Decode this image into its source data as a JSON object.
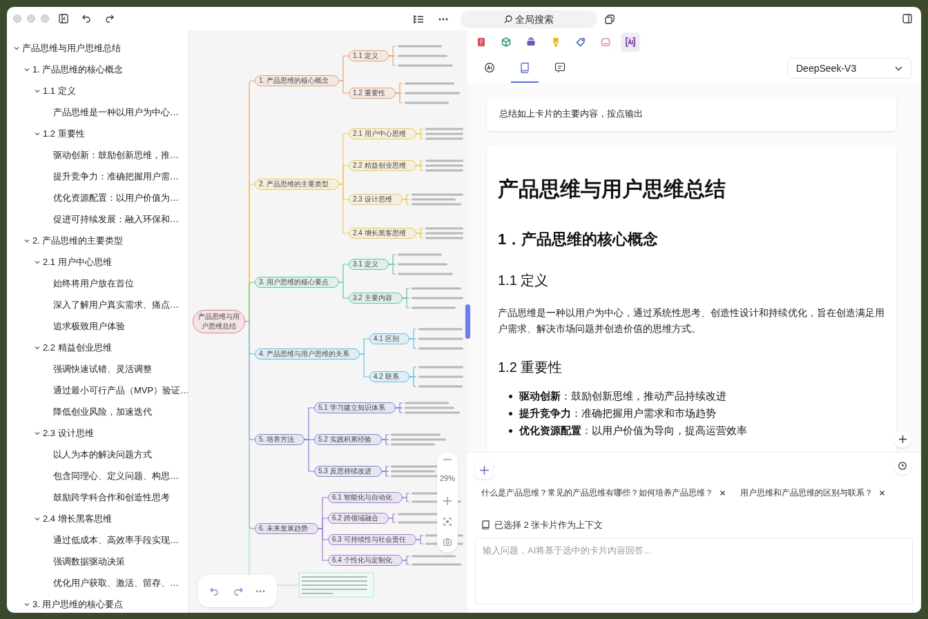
{
  "window": {
    "search_label": "全局搜索"
  },
  "outline": [
    {
      "text": "产品思维与用户思维总结",
      "expanded": true,
      "children": [
        {
          "text": "1. 产品思维的核心概念",
          "expanded": true,
          "children": [
            {
              "text": "1.1 定义",
              "expanded": true,
              "children": [
                {
                  "text": "产品思维是一种以用户为中心…"
                }
              ]
            },
            {
              "text": "1.2 重要性",
              "expanded": true,
              "children": [
                {
                  "text": "驱动创新：鼓励创新思维，推…"
                },
                {
                  "text": "提升竞争力：准确把握用户需…"
                },
                {
                  "text": "优化资源配置：以用户价值为…"
                },
                {
                  "text": "促进可持续发展：融入环保和…"
                }
              ]
            }
          ]
        },
        {
          "text": "2. 产品思维的主要类型",
          "expanded": true,
          "children": [
            {
              "text": "2.1 用户中心思维",
              "expanded": true,
              "children": [
                {
                  "text": "始终将用户放在首位"
                },
                {
                  "text": "深入了解用户真实需求、痛点…"
                },
                {
                  "text": "追求极致用户体验"
                }
              ]
            },
            {
              "text": "2.2 精益创业思维",
              "expanded": true,
              "children": [
                {
                  "text": "强调快速试错、灵活调整"
                },
                {
                  "text": "通过最小可行产品（MVP）验证…"
                },
                {
                  "text": "降低创业风险，加速迭代"
                }
              ]
            },
            {
              "text": "2.3 设计思维",
              "expanded": true,
              "children": [
                {
                  "text": "以人为本的解决问题方式"
                },
                {
                  "text": "包含同理心、定义问题、构思…"
                },
                {
                  "text": "鼓励跨学科合作和创造性思考"
                }
              ]
            },
            {
              "text": "2.4 增长黑客思维",
              "expanded": true,
              "children": [
                {
                  "text": "通过低成本、高效率手段实现…"
                },
                {
                  "text": "强调数据驱动决策"
                },
                {
                  "text": "优化用户获取、激活、留存、…"
                }
              ]
            }
          ]
        },
        {
          "text": "3. 用户思维的核心要点",
          "expanded": true
        }
      ]
    }
  ],
  "mindmap": {
    "root": "产品思维与用户思维总结",
    "branches": [
      {
        "label": "1. 产品思维的核心概念",
        "color": "#f0a06a",
        "children": [
          "1.1 定义",
          "1.2 重要性"
        ]
      },
      {
        "label": "2. 产品思维的主要类型",
        "color": "#f2c94c",
        "children": [
          "2.1 用户中心思维",
          "2.2 精益创业思维",
          "2.3 设计思维",
          "2.4 增长黑客思维"
        ]
      },
      {
        "label": "3. 用户思维的核心要点",
        "color": "#5cc9a0",
        "children": [
          "3.1 定义",
          "3.2 主要内容"
        ]
      },
      {
        "label": "4. 产品思维与用户思维的关系",
        "color": "#5bc0eb",
        "children": [
          "4.1 区别",
          "4.2 联系"
        ]
      },
      {
        "label": "5. 培养方法",
        "color": "#7b86d9",
        "children": [
          "5.1 学习建立知识体系",
          "5.2 实践积累经验",
          "5.3 反思持续改进"
        ]
      },
      {
        "label": "6. 未来发展趋势",
        "color": "#a27be0",
        "children": [
          "6.1 智能化与自动化",
          "6.2 跨领域融合",
          "6.3 可持续性与社会责任",
          "6.4 个性化与定制化"
        ]
      }
    ]
  },
  "canvas": {
    "zoom": "29%"
  },
  "tools": [
    {
      "kind": "note",
      "color": "#e5484d",
      "selected": false
    },
    {
      "kind": "cube",
      "color": "#30a46c",
      "selected": false
    },
    {
      "kind": "stack",
      "color": "#6e56cf",
      "selected": false
    },
    {
      "kind": "marker",
      "color": "#f5b400",
      "selected": false
    },
    {
      "kind": "tag",
      "color": "#3e63dd",
      "selected": false
    },
    {
      "kind": "frame",
      "color": "#f38bb5",
      "selected": false
    },
    {
      "kind": "ai",
      "color": "#8e4ec6",
      "selected": true
    }
  ],
  "tabs": [
    {
      "kind": "ai",
      "selected": false
    },
    {
      "kind": "book",
      "selected": true
    },
    {
      "kind": "chat",
      "selected": false
    }
  ],
  "model": "DeepSeek-V3",
  "prompt": "总结如上卡片的主要内容，按点输出",
  "answer": {
    "title": "产品思维与用户思维总结",
    "blocks": [
      {
        "kind": "h2",
        "text": "1．产品思维的核心概念"
      },
      {
        "kind": "h3",
        "text": "1.1 定义"
      },
      {
        "kind": "p",
        "text": "产品思维是一种以用户为中心，通过系统性思考、创造性设计和持续优化，旨在创造满足用户需求、解决市场问题并创造价值的思维方式。"
      },
      {
        "kind": "h3",
        "text": "1.2 重要性"
      },
      {
        "kind": "bullets",
        "items": [
          "**驱动创新**：鼓励创新思维，推动产品持续改进",
          "**提升竞争力**：准确把握用户需求和市场趋势",
          "**优化资源配置**：以用户价值为导向，提高运营效率"
        ]
      }
    ]
  },
  "suggestions": [
    {
      "text": "什么是产品思维？常见的产品思维有哪些？如何培养产品思维？"
    },
    {
      "text": "用户思维和产品思维的区别与联系？"
    }
  ],
  "context_note": "已选择 2 张卡片作为上下文",
  "input": {
    "placeholder": "输入问题，AI将基于选中的卡片内容回答..."
  }
}
